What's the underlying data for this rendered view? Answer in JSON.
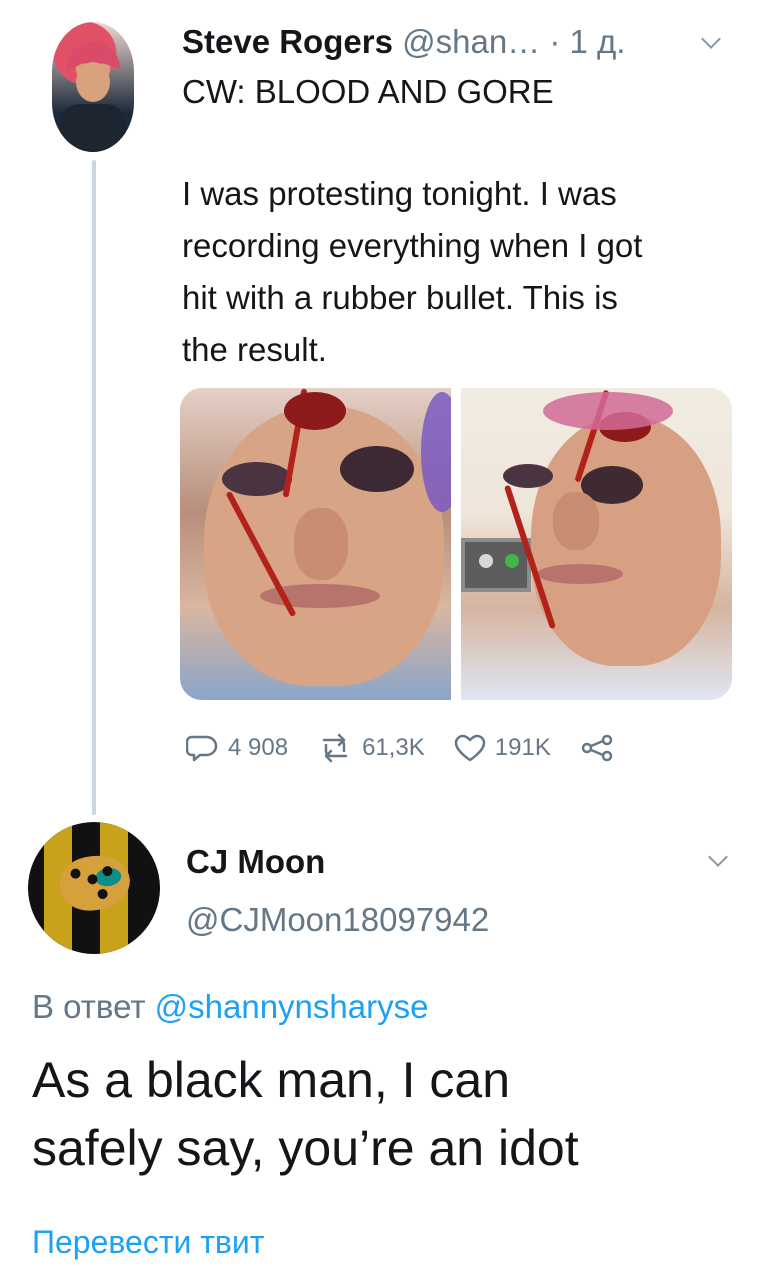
{
  "tweet": {
    "author": {
      "name": "Steve Rogers",
      "handle": "@shan…",
      "time": "1 д."
    },
    "content_warning": "CW: BLOOD AND GORE",
    "text": "I was protesting tonight. I was\nrecording everything when I got\nhit with a rubber bullet. This is\nthe result.",
    "actions": {
      "reply_count": "4 908",
      "retweet_count": "61,3K",
      "like_count": "191K"
    }
  },
  "reply": {
    "author": {
      "name": "CJ Moon",
      "handle": "@CJMoon18097942"
    },
    "context_prefix": "В ответ",
    "reply_to": "@shannynsharyse",
    "text": "As a black man, I can\nsafely say, you’re an idot",
    "translate_label": "Перевести твит"
  },
  "colors": {
    "text": "#14171a",
    "muted": "#657786",
    "accent": "#1da1f2",
    "thread_line": "#ccd6dd"
  },
  "icons": {
    "reply": "reply-icon",
    "retweet": "retweet-icon",
    "like": "heart-icon",
    "share": "share-icon",
    "menu": "chevron-down-icon"
  }
}
